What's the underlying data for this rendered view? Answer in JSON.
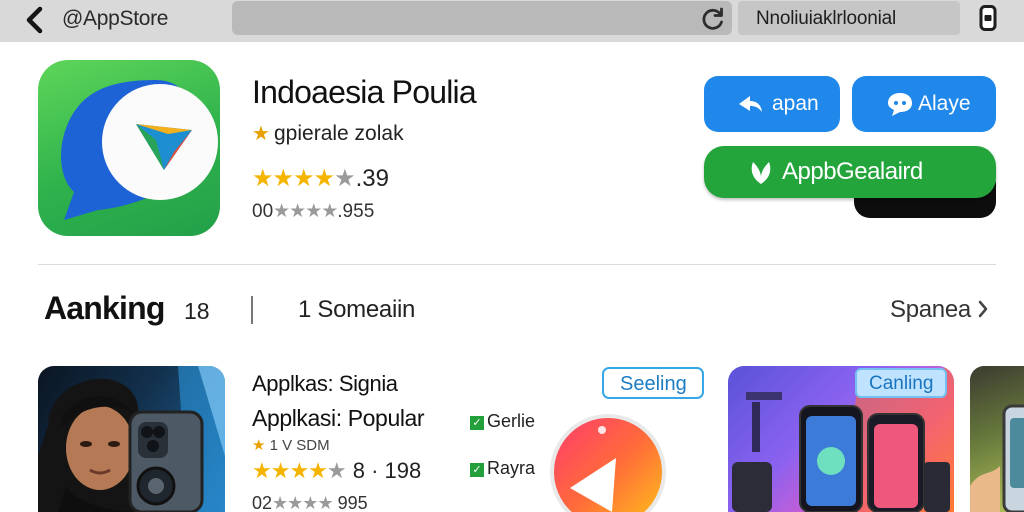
{
  "topbar": {
    "back_label": "‹",
    "store_label": "@AppStore",
    "user_label": "Nnoliuiaklrloonial"
  },
  "app": {
    "name": "Indoaesia Poulia",
    "developer": "gpierale zolak",
    "rating_stars": "★★★★",
    "rating_value": ".39",
    "reviews_prefix": "00",
    "reviews_value": ".955"
  },
  "buttons": {
    "open_label": "apan",
    "alaye_label": "Alaye",
    "get_label": "AppbGealaird"
  },
  "ranking": {
    "title": "Aanking",
    "count": "18",
    "subtitle": "1 Someaiin",
    "see_all": "Spanea"
  },
  "list": [
    {
      "title": "Applkas: Signia",
      "subtitle": "Applkasi: Popular",
      "meta": "1 V SDM",
      "rating_stars": "★★★★",
      "rating_value": "8 · 198",
      "reviews_prefix": "02",
      "reviews_value": "995"
    }
  ],
  "tags": {
    "seeing": "Seeling",
    "coming": "Canling"
  },
  "checks": {
    "first": "Gerlie",
    "second": "Rayra"
  },
  "colors": {
    "accent_blue": "#1f88ea",
    "accent_green": "#23a53c",
    "star_gold": "#f5b400"
  }
}
